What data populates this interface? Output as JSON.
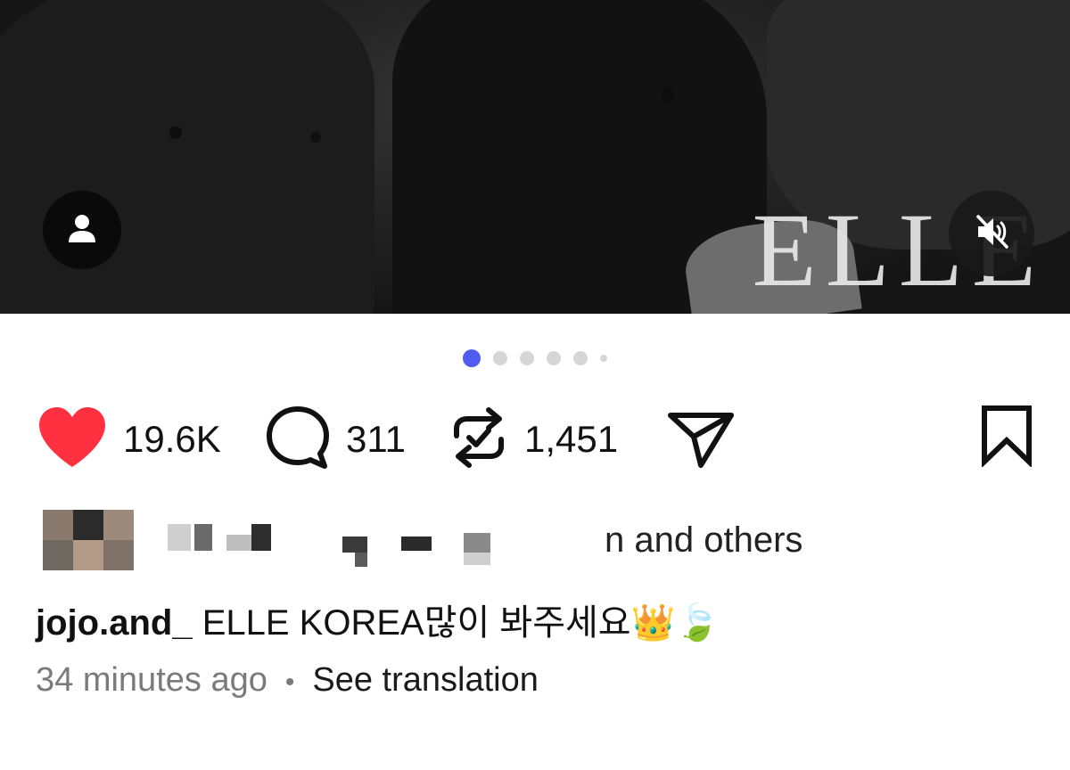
{
  "post": {
    "media": {
      "brand_logo": "ELLE",
      "tag_icon": "person-icon",
      "mute_icon": "speaker-muted-icon",
      "carousel": {
        "total": 6,
        "active_index": 0,
        "accent": "#4f5bf2"
      }
    },
    "actions": {
      "like": {
        "icon": "heart-filled-icon",
        "count": "19.6K",
        "color": "#ff3040"
      },
      "comment": {
        "icon": "comment-icon",
        "count": "311"
      },
      "repost": {
        "icon": "repost-icon",
        "count": "1,451"
      },
      "share": {
        "icon": "send-icon"
      },
      "save": {
        "icon": "bookmark-icon"
      }
    },
    "liked_by": {
      "text": "n and others"
    },
    "caption": {
      "username": "jojo.and_",
      "text": " ELLE KOREA많이 봐주세요👑🍃"
    },
    "meta": {
      "time": "34 minutes ago",
      "separator": "•",
      "translate_label": "See translation"
    }
  }
}
